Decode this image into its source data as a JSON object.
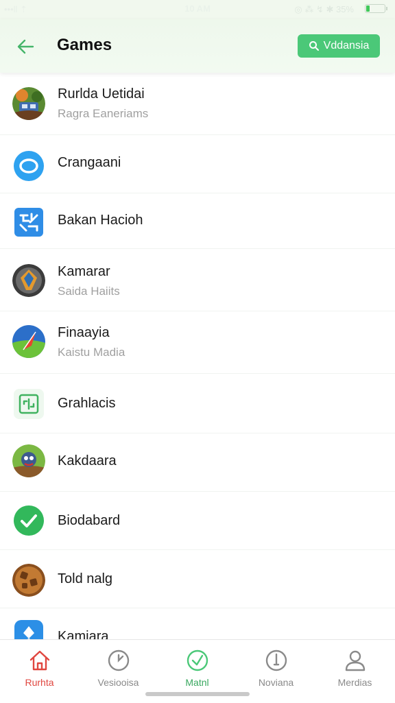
{
  "status_bar": {
    "left": "•••ll ⇡",
    "time": "10 AM",
    "right": "◎ ⁂ ↯ ✱ 35%",
    "battery_level": 0.18
  },
  "header": {
    "title": "Games",
    "search_label": "Vddansia"
  },
  "games": [
    {
      "title": "Rurlda Uetidai",
      "subtitle": "Ragra Eaneriams",
      "icon": "jungle-game-icon"
    },
    {
      "title": "Crangaani",
      "subtitle": "",
      "icon": "ring-icon"
    },
    {
      "title": "Bakan Hacioh",
      "subtitle": "",
      "icon": "tile-puzzle-icon"
    },
    {
      "title": "Kamarar",
      "subtitle": "Saida Haiits",
      "icon": "warrior-shield-icon"
    },
    {
      "title": "Finaayia",
      "subtitle": "Kaistu Madia",
      "icon": "field-arrow-icon"
    },
    {
      "title": "Grahlacis",
      "subtitle": "",
      "icon": "grid-board-icon"
    },
    {
      "title": "Kakdaara",
      "subtitle": "",
      "icon": "creature-icon"
    },
    {
      "title": "Biodabard",
      "subtitle": "",
      "icon": "check-icon"
    },
    {
      "title": "Told nalg",
      "subtitle": "",
      "icon": "cookie-icon"
    },
    {
      "title": "Kamiara",
      "subtitle": "",
      "icon": "diamond-shield-icon"
    }
  ],
  "tabs": [
    {
      "label": "Rurhta",
      "icon": "home-icon",
      "active": true
    },
    {
      "label": "Vesiooisa",
      "icon": "clock-icon",
      "active": false
    },
    {
      "label": "Matnl",
      "icon": "check-circle-icon",
      "active": false
    },
    {
      "label": "Noviana",
      "icon": "timer-icon",
      "active": false
    },
    {
      "label": "Merdias",
      "icon": "person-icon",
      "active": false
    }
  ],
  "colors": {
    "accent_green": "#4bc878",
    "active_tab": "#e0463f",
    "header_bg": "#eef8ec"
  }
}
